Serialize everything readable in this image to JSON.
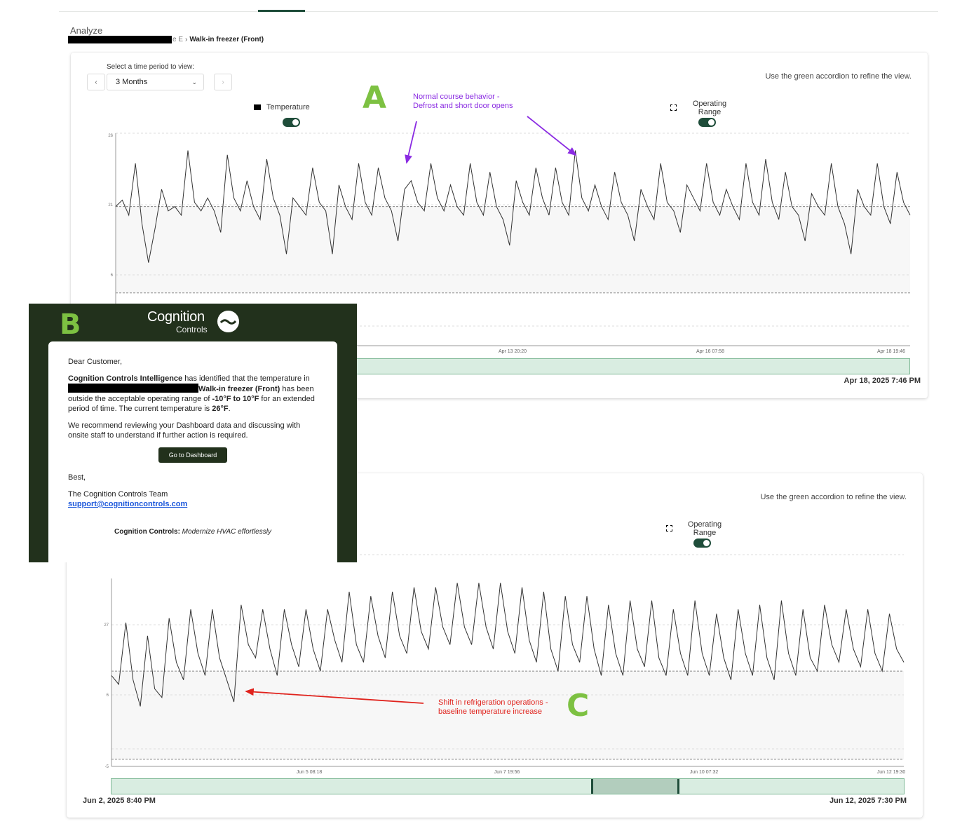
{
  "page": {
    "title": "Analyze",
    "breadcrumb": {
      "previous": "e E",
      "separator": "›",
      "current": "Walk-in freezer (Front)"
    }
  },
  "panel_a": {
    "period_label": "Select a time period to view:",
    "period_value": "3 Months",
    "prev_icon": "‹",
    "next_icon": "›",
    "hint": "Use the green accordion to refine the view.",
    "legend_temperature": "Temperature",
    "legend_range": "Operating Range",
    "end_date": "Apr 18, 2025 7:46 PM"
  },
  "panel_c": {
    "hint": "Use the green accordion to refine the view.",
    "legend_range": "Operating Range",
    "start_date": "Jun 2, 2025 8:40 PM",
    "end_date": "Jun 12, 2025 7:30 PM"
  },
  "annotations": {
    "marker_a": "A",
    "marker_b": "B",
    "marker_c": "C",
    "normal_line1": "Normal course behavior -",
    "normal_line2": "Defrost and short door opens",
    "shift_line1": "Shift in refrigeration operations -",
    "shift_line2": "baseline temperature increase",
    "arrow_purple_color": "#8a2be2",
    "arrow_red_color": "#e0231d"
  },
  "email": {
    "brand_name": "Cognition",
    "brand_sub": "Controls",
    "greeting": "Dear Customer,",
    "intro_bold": "Cognition Controls Intelligence",
    "intro_text": " has identified that the temperature in ",
    "device_bold": "Walk-in freezer (Front)",
    "body_text": " has been outside the acceptable operating range of ",
    "range_bold": "-10°F to 10°F",
    "period_text": " for an extended period of time. The current temperature is ",
    "current_bold": "26°F",
    "period_end": ".",
    "recommend": "We recommend reviewing your Dashboard data and discussing with onsite staff to understand if further action is required.",
    "button": "Go to Dashboard",
    "sign_off": "Best,",
    "team": "The Cognition Controls Team",
    "support_email": "support@cognitioncontrols.com",
    "tagline_bold": "Cognition Controls:",
    "tagline_text": " Modernize HVAC effortlessly"
  },
  "chart_data": [
    {
      "type": "line",
      "name": "Panel A temperature",
      "x_ticks": [
        "Apr 13 20:20",
        "Apr 16 07:58",
        "Apr 18 19:46"
      ],
      "y_ticks": [
        "26",
        "21",
        "6"
      ],
      "operating_range": [
        -10,
        10
      ],
      "series": [
        {
          "values": [
            10,
            11.5,
            8,
            20,
            6,
            -3,
            5,
            14,
            9,
            10,
            8,
            23,
            11,
            9,
            12,
            9,
            4,
            22,
            12,
            9,
            16,
            10,
            7,
            21,
            12,
            8,
            -1,
            12,
            10,
            8,
            19,
            11,
            9,
            -1,
            15,
            10,
            7,
            20,
            11,
            8,
            19,
            12,
            9,
            2,
            14,
            16,
            11,
            9,
            20,
            12,
            9,
            15,
            10,
            8,
            20,
            11,
            8,
            18,
            10,
            7,
            1,
            16,
            11,
            8,
            19,
            12,
            8,
            19,
            11,
            8,
            23,
            12,
            9,
            15,
            10,
            7,
            18,
            11,
            8,
            2,
            14,
            10,
            7,
            20,
            11,
            9,
            4,
            15,
            12,
            9,
            20,
            11,
            8,
            14,
            10,
            7,
            20,
            11,
            8,
            21,
            11,
            7,
            18,
            10,
            8,
            2,
            13,
            10,
            8,
            20,
            10,
            6,
            -1,
            14,
            10,
            8,
            20,
            10,
            6,
            18,
            11,
            8
          ]
        }
      ]
    },
    {
      "type": "line",
      "name": "Panel C temperature",
      "x_ticks": [
        "Jun 5 08:18",
        "Jun 7 19:56",
        "Jun 10 07:32",
        "Jun 12 19:30"
      ],
      "y_ticks": [
        "27",
        "6",
        "-5"
      ],
      "operating_range": [
        -10,
        10
      ],
      "series": [
        {
          "values": [
            9,
            7,
            21,
            8,
            2,
            18,
            6,
            4,
            22,
            12,
            8,
            24,
            14,
            9,
            24,
            13,
            8,
            3,
            25,
            16,
            13,
            24,
            15,
            9,
            24,
            16,
            11,
            24,
            15,
            10,
            24,
            17,
            12,
            28,
            16,
            12,
            27,
            18,
            13,
            28,
            18,
            14,
            29,
            19,
            15,
            29,
            20,
            16,
            30,
            20,
            16,
            30,
            20,
            15,
            30,
            19,
            14,
            29,
            17,
            12,
            28,
            15,
            10,
            27,
            16,
            12,
            27,
            15,
            9,
            25,
            14,
            9,
            26,
            15,
            11,
            26,
            13,
            9,
            24,
            14,
            9,
            26,
            14,
            9,
            23,
            13,
            8,
            24,
            14,
            9,
            25,
            13,
            8,
            26,
            14,
            9,
            24,
            13,
            10,
            25,
            16,
            12,
            24,
            15,
            11,
            24,
            14,
            10,
            23,
            15,
            12
          ]
        }
      ]
    }
  ]
}
